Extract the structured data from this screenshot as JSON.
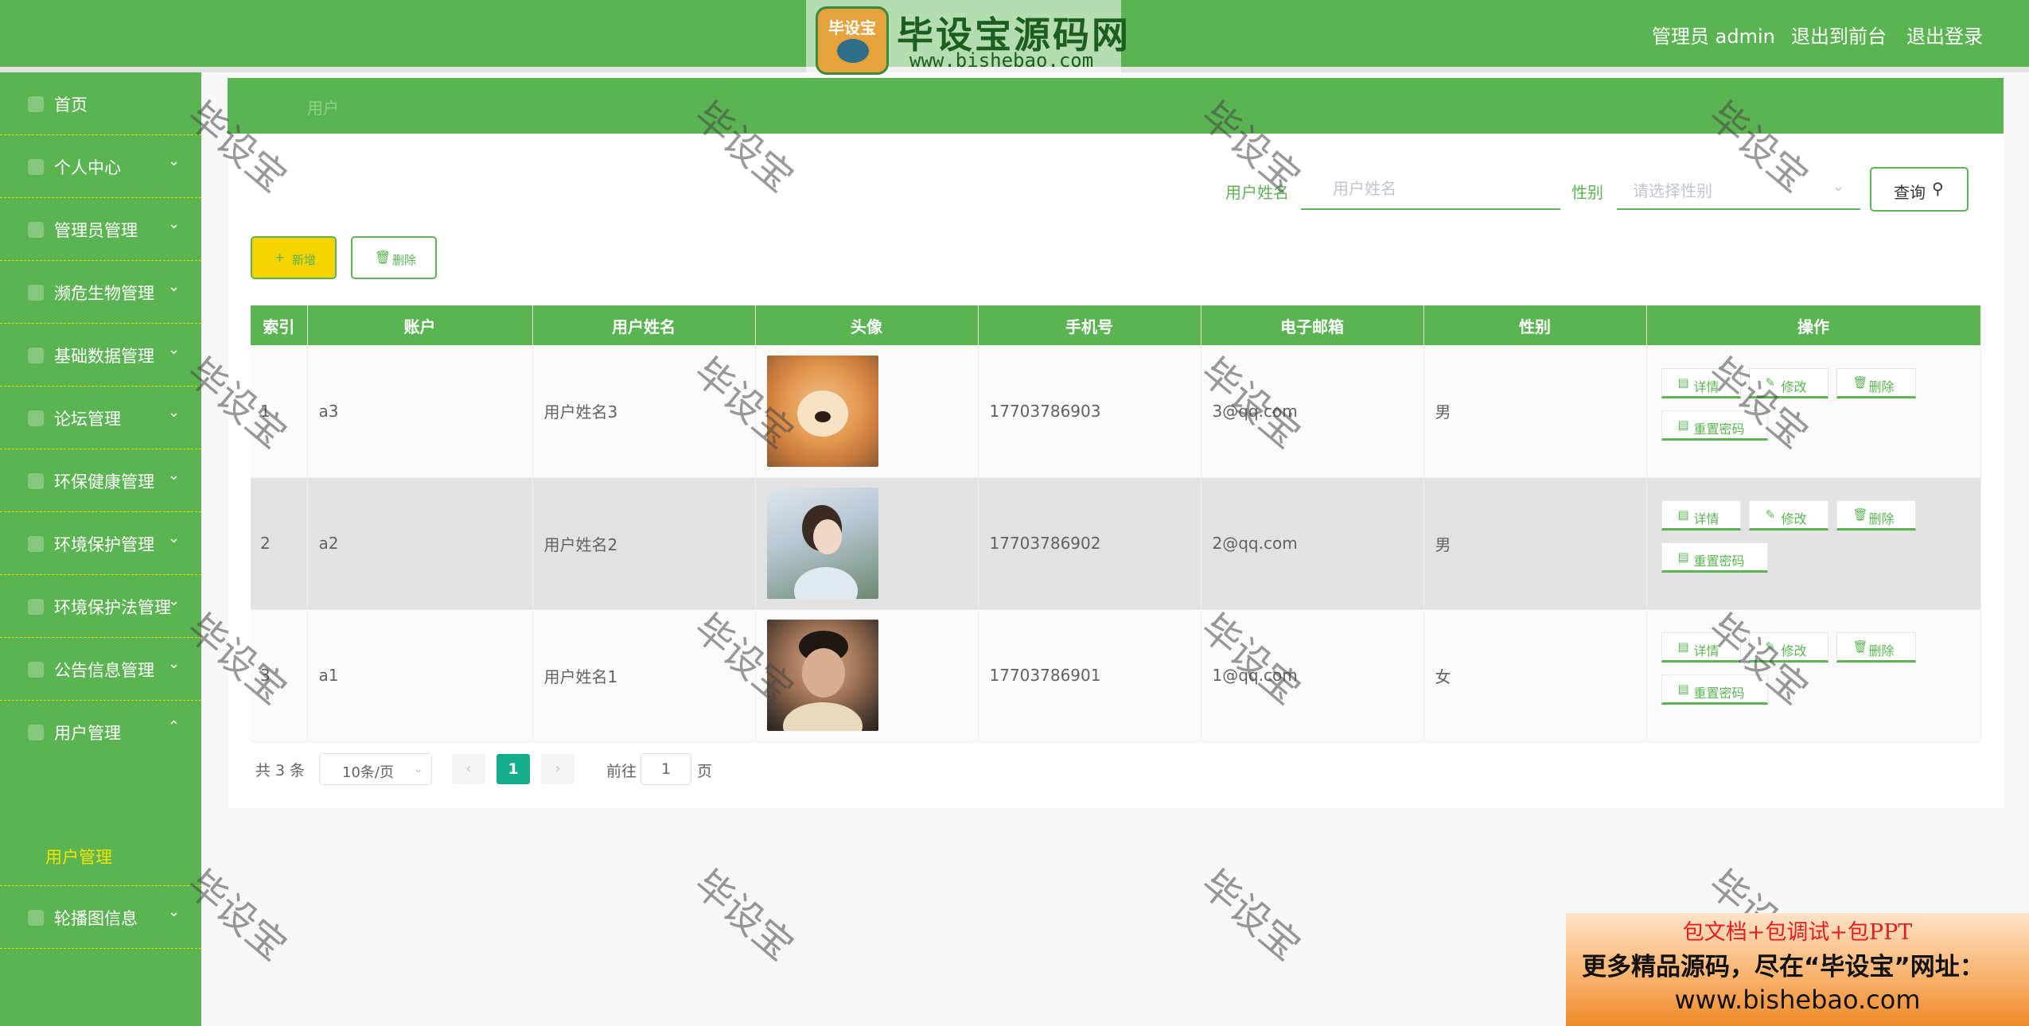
{
  "header": {
    "logo_badge": "毕设宝",
    "logo_title": "毕设宝源码网",
    "logo_url": "www.bishebao.com",
    "admin_label": "管理员 admin",
    "front_link": "退出到前台",
    "logout_link": "退出登录",
    "brand_color": "#5bb452"
  },
  "sidebar": {
    "items": [
      {
        "label": "首页",
        "icon": "home-icon"
      },
      {
        "label": "个人中心",
        "icon": "user-icon"
      },
      {
        "label": "管理员管理",
        "icon": "admin-icon"
      },
      {
        "label": "濒危生物管理",
        "icon": "species-icon"
      },
      {
        "label": "基础数据管理",
        "icon": "data-icon"
      },
      {
        "label": "论坛管理",
        "icon": "forum-icon"
      },
      {
        "label": "环保健康管理",
        "icon": "health-icon"
      },
      {
        "label": "环境保护管理",
        "icon": "environment-icon"
      },
      {
        "label": "环境保护法管理",
        "icon": "law-icon"
      },
      {
        "label": "公告信息管理",
        "icon": "notice-icon"
      },
      {
        "label": "用户管理",
        "icon": "users-icon"
      },
      {
        "label": "轮播图信息",
        "icon": "carousel-icon"
      }
    ],
    "active_sub": "用户管理"
  },
  "breadcrumb": "用户",
  "search": {
    "name_label": "用户姓名",
    "name_placeholder": "用户姓名",
    "gender_label": "性别",
    "gender_placeholder": "请选择性别",
    "query_label": "查询"
  },
  "actions": {
    "add_label": "新增",
    "delete_label": "删除"
  },
  "table": {
    "columns": [
      "索引",
      "账户",
      "用户姓名",
      "头像",
      "手机号",
      "电子邮箱",
      "性别",
      "操作"
    ],
    "rows": [
      {
        "index": "1",
        "account": "a3",
        "name": "用户姓名3",
        "avatar": "shiba-dog-photo",
        "phone": "17703786903",
        "email": "3@qq.com",
        "gender": "男"
      },
      {
        "index": "2",
        "account": "a2",
        "name": "用户姓名2",
        "avatar": "girl-profile-photo",
        "phone": "17703786902",
        "email": "2@qq.com",
        "gender": "男"
      },
      {
        "index": "3",
        "account": "a1",
        "name": "用户姓名1",
        "avatar": "boy-selfie-photo",
        "phone": "17703786901",
        "email": "1@qq.com",
        "gender": "女"
      }
    ],
    "ops": {
      "detail": "详情",
      "edit": "修改",
      "delete": "删除",
      "reset": "重置密码"
    }
  },
  "pagination": {
    "total": "共 3 条",
    "page_size": "10条/页",
    "prev": "‹",
    "next": "›",
    "current": "1",
    "goto_prefix": "前往",
    "goto_value": "1",
    "goto_suffix": "页"
  },
  "watermark": "毕设宝",
  "ad": {
    "line1": "包文档+包调试+包PPT",
    "line2": "更多精品源码，尽在“毕设宝”网址：",
    "line3": "www.bishebao.com"
  }
}
